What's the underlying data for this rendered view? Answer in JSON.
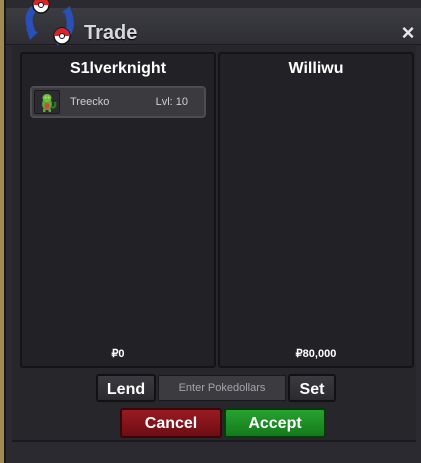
{
  "window": {
    "title": "Trade",
    "close_icon": "×"
  },
  "left_panel": {
    "player_name": "S1lverknight",
    "items": [
      {
        "name": "Treecko",
        "level": "Lvl: 10",
        "icon": "treecko-sprite-icon"
      }
    ],
    "money": "₽0"
  },
  "right_panel": {
    "player_name": "Williwu",
    "items": [],
    "money": "₽80,000"
  },
  "controls": {
    "lend_label": "Lend",
    "pokedollars_placeholder": "Enter Pokedollars",
    "set_label": "Set",
    "cancel_label": "Cancel",
    "accept_label": "Accept"
  },
  "colors": {
    "cancel": "#8b1219",
    "accept": "#1f9228",
    "window_bg": "#2a2a30",
    "game_bg": "#a08a52"
  }
}
